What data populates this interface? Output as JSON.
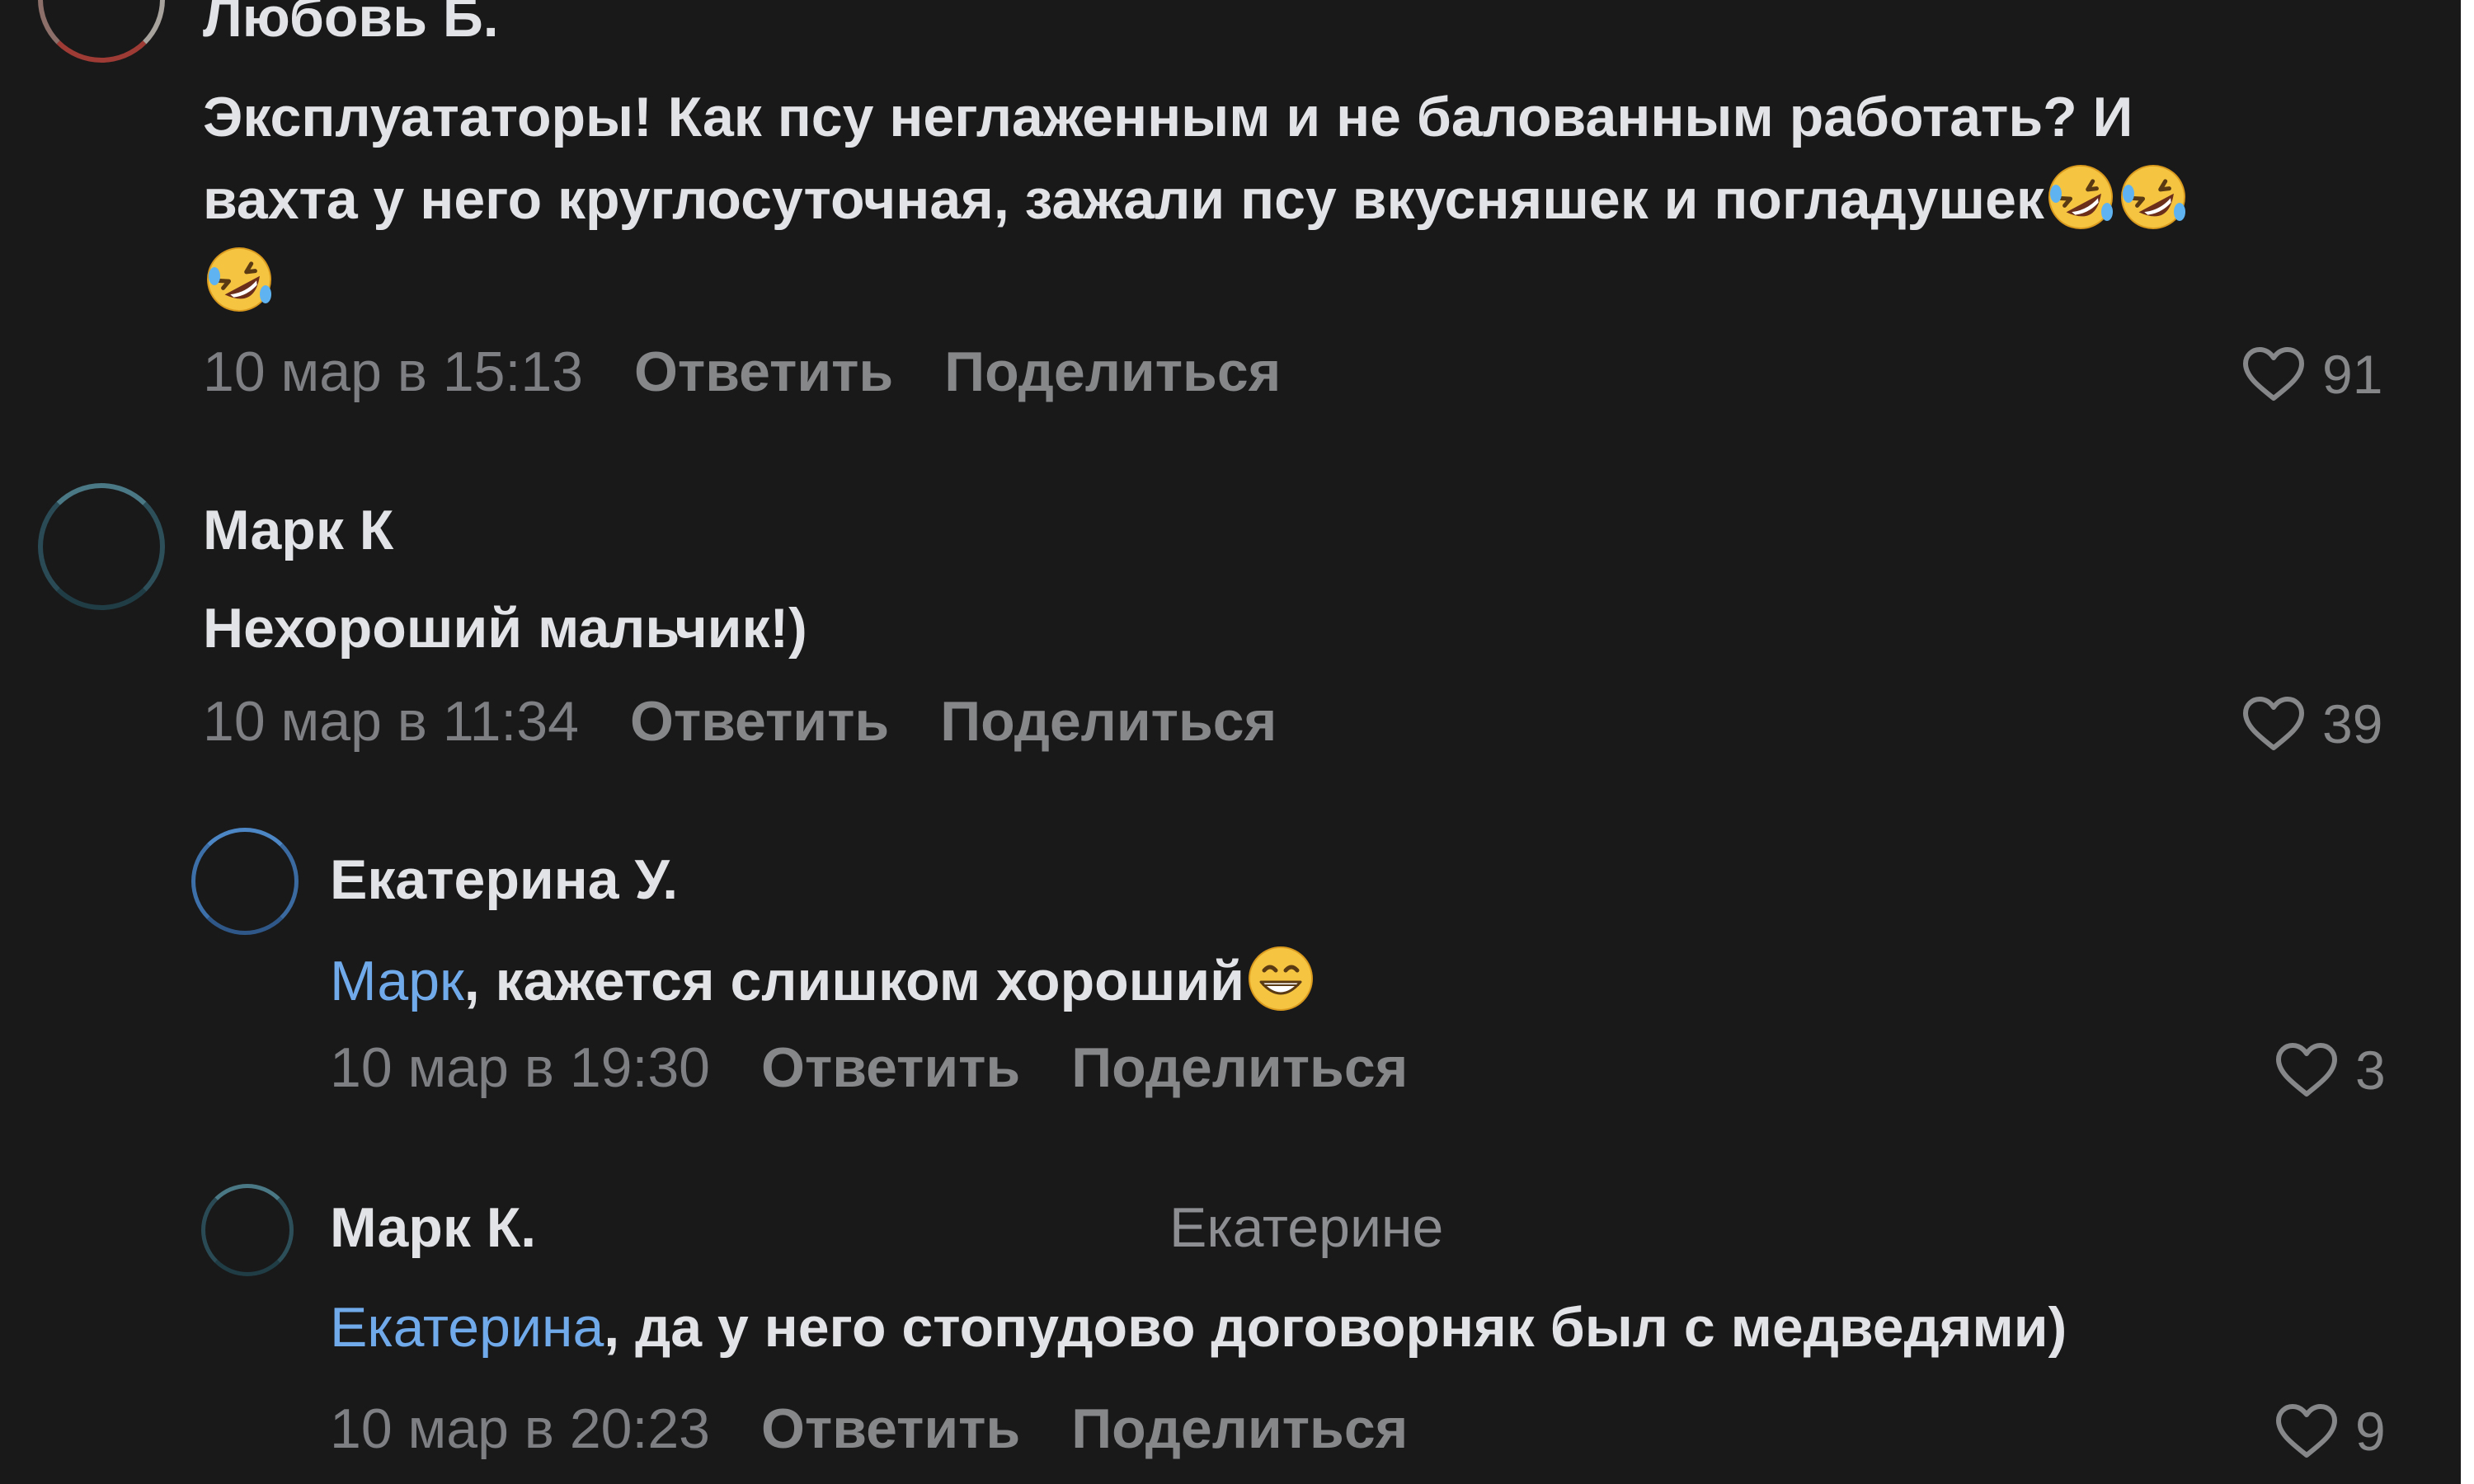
{
  "comments": [
    {
      "author": "Любовь Б.",
      "text_lines": [
        "Эксплуататоры! Как псу неглаженным и не балованным работать? И",
        "вахта у него круглосуточная, зажали псу вкусняшек и погладушек"
      ],
      "emoji": [
        "rolling-on-floor-laughing",
        "rolling-on-floor-laughing",
        "rolling-on-floor-laughing"
      ],
      "date": "10 мар в 15:13",
      "reply_label": "Ответить",
      "share_label": "Поделиться",
      "likes": "91",
      "avatar_ring_color": "#9e3b35"
    },
    {
      "author": "Марк К",
      "text": "Нехороший мальчик!)",
      "date": "10 мар в 11:34",
      "reply_label": "Ответить",
      "share_label": "Поделиться",
      "likes": "39",
      "avatar_ring_color": "#2f5560"
    },
    {
      "author": "Екатерина У.",
      "mention": "Марк",
      "text": ", кажется слишком хороший",
      "emoji": [
        "grinning-face"
      ],
      "date": "10 мар в 19:30",
      "reply_label": "Ответить",
      "share_label": "Поделиться",
      "likes": "3",
      "avatar_ring_color": "#3c6fa8"
    },
    {
      "author": "Марк К.",
      "reply_to": "Екатерине",
      "mention": "Екатерина",
      "text": ", да у него стопудово договорняк был с медведями)",
      "date": "10 мар в 20:23",
      "reply_label": "Ответить",
      "share_label": "Поделиться",
      "likes": "9",
      "avatar_ring_color": "#2f5560"
    }
  ],
  "icons": {
    "like": "heart-outline-icon",
    "emoji_laugh": "rolling-on-floor-laughing-emoji",
    "emoji_grin": "grinning-face-emoji"
  },
  "colors": {
    "background": "#19191a",
    "text": "#e2e3e6",
    "secondary": "#7d7f83",
    "mention": "#71aaeb"
  }
}
